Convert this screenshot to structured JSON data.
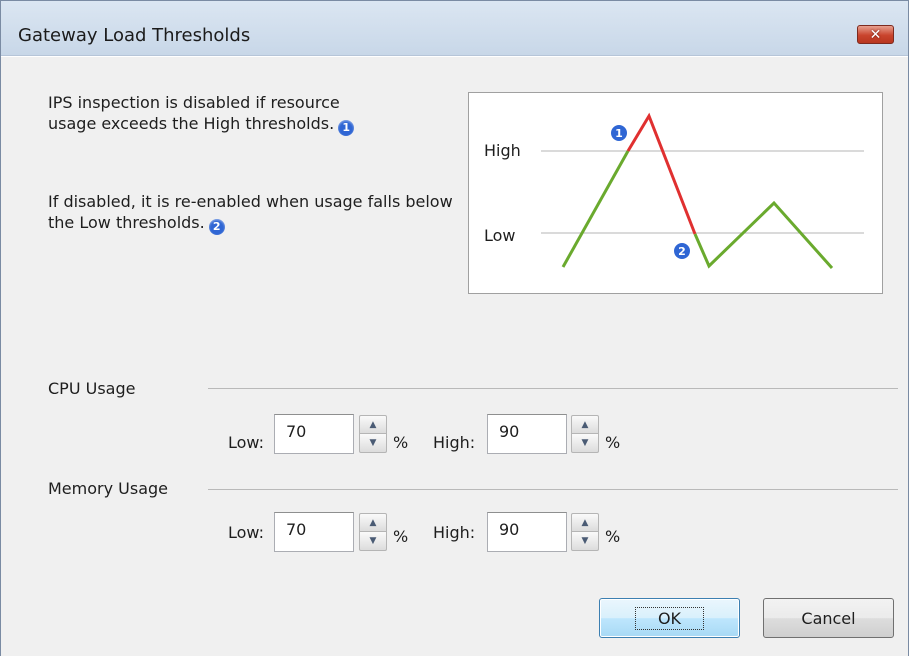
{
  "window": {
    "title": "Gateway Load Thresholds",
    "close_label": "✕",
    "close_icon": "close-icon"
  },
  "description": {
    "line1": "IPS inspection is disabled if resource usage exceeds the High thresholds.",
    "badge1": "1",
    "line2": "If disabled, it is re-enabled when usage falls below the Low thresholds.",
    "badge2": "2"
  },
  "diagram": {
    "high_label": "High",
    "low_label": "Low",
    "marker1": "1",
    "marker2": "2",
    "colors": {
      "below": "#6aaa2e",
      "above": "#e03030",
      "threshold_line": "#b4b4b4",
      "badge": "#2f66d4"
    }
  },
  "cpu": {
    "section_label": "CPU Usage",
    "low_label": "Low:",
    "low_value": "70",
    "high_label": "High:",
    "high_value": "90",
    "unit": "%"
  },
  "memory": {
    "section_label": "Memory Usage",
    "low_label": "Low:",
    "low_value": "70",
    "high_label": "High:",
    "high_value": "90",
    "unit": "%"
  },
  "buttons": {
    "ok": "OK",
    "cancel": "Cancel"
  }
}
